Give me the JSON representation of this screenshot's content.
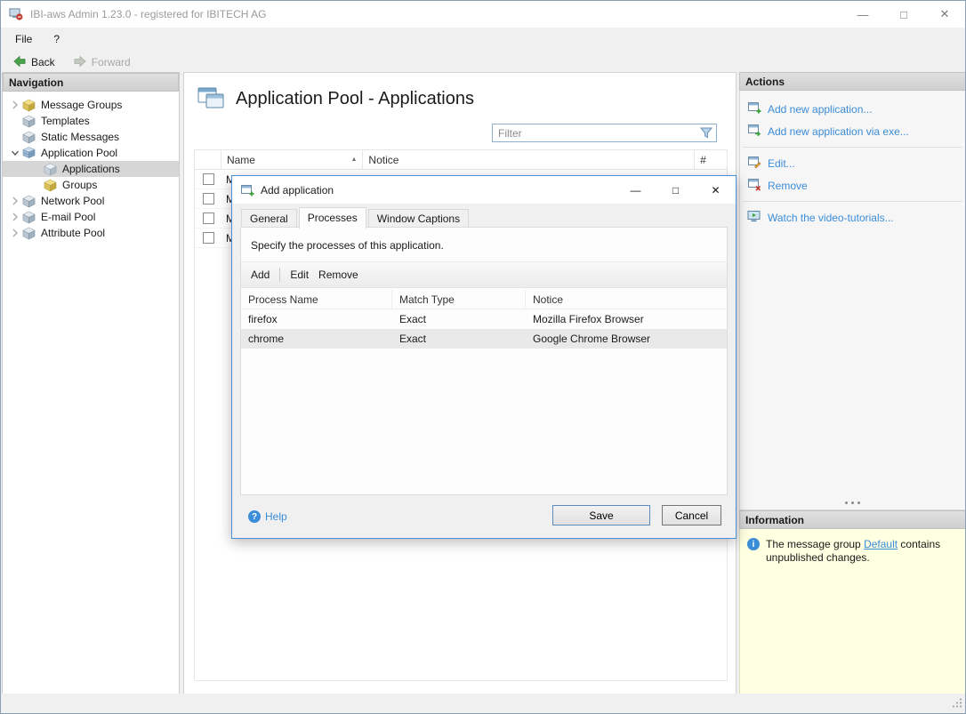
{
  "window": {
    "title": "IBI-aws Admin 1.23.0 - registered for IBITECH AG",
    "minimize": "—",
    "maximize": "□",
    "close": "✕"
  },
  "menubar": {
    "file": "File",
    "help": "?"
  },
  "toolbar": {
    "back": "Back",
    "forward": "Forward"
  },
  "navigation": {
    "header": "Navigation",
    "items": [
      {
        "label": "Message Groups",
        "icon": "message-groups-icon",
        "state": "collapsed"
      },
      {
        "label": "Templates",
        "icon": "templates-icon",
        "state": "leaf"
      },
      {
        "label": "Static Messages",
        "icon": "static-messages-icon",
        "state": "leaf"
      },
      {
        "label": "Application Pool",
        "icon": "application-pool-icon",
        "state": "expanded"
      },
      {
        "label": "Applications",
        "icon": "applications-icon",
        "state": "leaf",
        "selected": true
      },
      {
        "label": "Groups",
        "icon": "groups-icon",
        "state": "leaf"
      },
      {
        "label": "Network Pool",
        "icon": "network-pool-icon",
        "state": "collapsed"
      },
      {
        "label": "E-mail Pool",
        "icon": "email-pool-icon",
        "state": "collapsed"
      },
      {
        "label": "Attribute Pool",
        "icon": "attribute-pool-icon",
        "state": "collapsed"
      }
    ]
  },
  "main": {
    "title": "Application Pool - Applications",
    "filter": {
      "placeholder": "Filter"
    },
    "table": {
      "sort_glyph": "▲",
      "columns": {
        "name": "Name",
        "notice": "Notice",
        "count": "#"
      },
      "rows": [
        {
          "name": "M"
        },
        {
          "name": "M"
        },
        {
          "name": "M"
        },
        {
          "name": "M"
        }
      ]
    }
  },
  "dialog": {
    "title": "Add application",
    "minimize": "—",
    "maximize": "□",
    "close": "✕",
    "tabs": [
      {
        "label": "General",
        "active": false
      },
      {
        "label": "Processes",
        "active": true
      },
      {
        "label": "Window Captions",
        "active": false
      }
    ],
    "description": "Specify the processes of this application.",
    "toolbar": {
      "add": "Add",
      "edit": "Edit",
      "remove": "Remove"
    },
    "table": {
      "columns": {
        "process_name": "Process Name",
        "match_type": "Match Type",
        "notice": "Notice"
      },
      "rows": [
        {
          "process_name": "firefox",
          "match_type": "Exact",
          "notice": "Mozilla Firefox Browser",
          "selected": false
        },
        {
          "process_name": "chrome",
          "match_type": "Exact",
          "notice": "Google Chrome Browser",
          "selected": true
        }
      ]
    },
    "help": "Help",
    "help_glyph": "?",
    "save": "Save",
    "cancel": "Cancel"
  },
  "actions": {
    "header": "Actions",
    "items": [
      {
        "label": "Add new application...",
        "icon": "add-application-icon"
      },
      {
        "label": "Add new application via exe...",
        "icon": "add-application-exe-icon"
      },
      {
        "label": "Edit...",
        "icon": "edit-icon"
      },
      {
        "label": "Remove",
        "icon": "remove-icon"
      },
      {
        "label": "Watch the video-tutorials...",
        "icon": "video-tutorials-icon"
      }
    ]
  },
  "information": {
    "header": "Information",
    "info_glyph": "i",
    "text_before": "The message group ",
    "link": "Default",
    "text_after": " contains unpublished changes."
  },
  "colors": {
    "link": "#3b8dd8",
    "info_background": "#ffffe1",
    "dialog_border": "#4a90d9",
    "selection": "#d6d6d6"
  }
}
